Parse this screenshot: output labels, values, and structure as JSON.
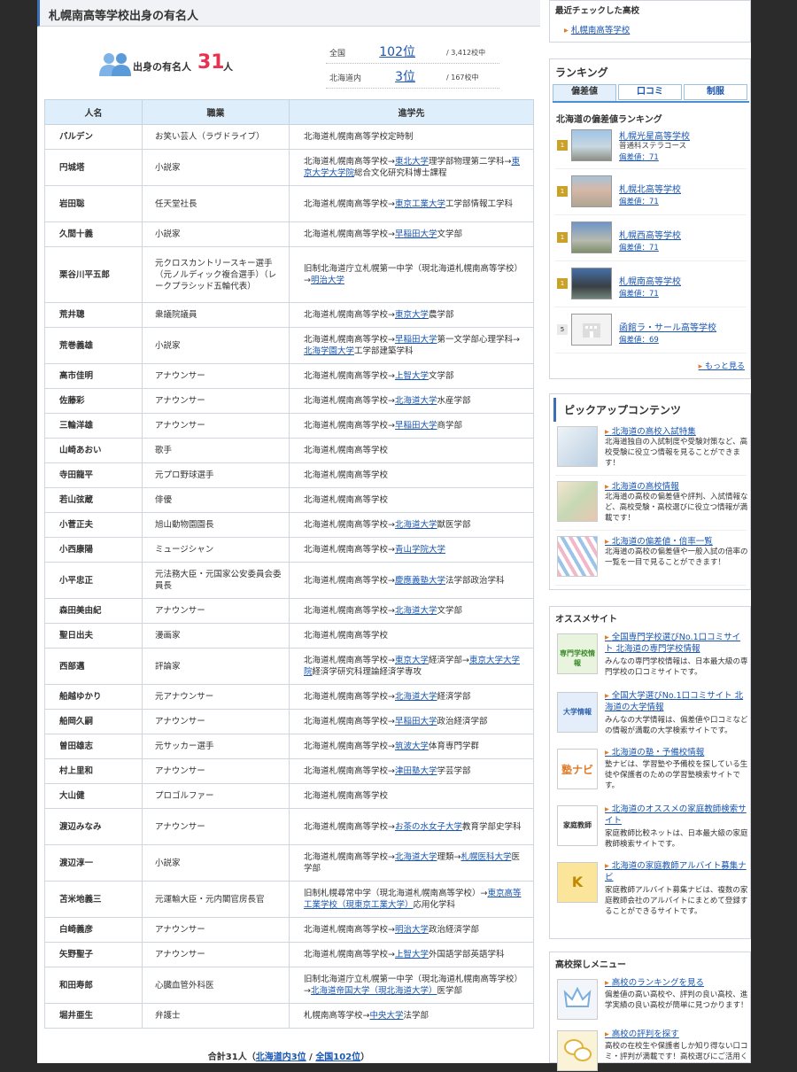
{
  "main": {
    "title": "札幌南高等学校出身の有名人",
    "count_label": "出身の有名人",
    "count": "31",
    "count_unit": "人",
    "ranks": [
      {
        "area": "全国",
        "pos": "102位",
        "total": "/ 3,412校中"
      },
      {
        "area": "北海道内",
        "pos": "3位",
        "total": "/ 167校中"
      }
    ],
    "headers": [
      "人名",
      "職業",
      "進学先"
    ],
    "rows": [
      {
        "name": "パルデン",
        "job": "お笑い芸人（ラヴドライブ）",
        "edu": [
          "北海道札幌南高等学校定時制"
        ]
      },
      {
        "name": "円城塔",
        "job": "小説家",
        "edu": [
          "北海道札幌南高等学校→",
          "@東北大学",
          "理学部物理第二学科→",
          "@東京大学大学院",
          "総合文化研究科博士課程"
        ]
      },
      {
        "name": "岩田聡",
        "job": "任天堂社長",
        "edu": [
          "北海道札幌南高等学校→",
          "@東京工業大学",
          "工学部情報工学科"
        ]
      },
      {
        "name": "久間十義",
        "job": "小説家",
        "edu": [
          "北海道札幌南高等学校→",
          "@早稲田大学",
          "文学部"
        ]
      },
      {
        "name": "栗谷川平五郎",
        "job": "元クロスカントリースキー選手（元ノルディック複合選手）（レークプラシッド五輪代表）",
        "edu": [
          "旧制北海道庁立札幌第一中学（現北海道札幌南高等学校）→",
          "@明治大学"
        ]
      },
      {
        "name": "荒井聰",
        "job": "衆議院議員",
        "edu": [
          "北海道札幌南高等学校→",
          "@東京大学",
          "農学部"
        ]
      },
      {
        "name": "荒巻義雄",
        "job": "小説家",
        "edu": [
          "北海道札幌南高等学校→",
          "@早稲田大学",
          "第一文学部心理学科→",
          "@北海学園大学",
          "工学部建築学科"
        ]
      },
      {
        "name": "高市佳明",
        "job": "アナウンサー",
        "edu": [
          "北海道札幌南高等学校→",
          "@上智大学",
          "文学部"
        ]
      },
      {
        "name": "佐藤彩",
        "job": "アナウンサー",
        "edu": [
          "北海道札幌南高等学校→",
          "@北海道大学",
          "水産学部"
        ]
      },
      {
        "name": "三輪洋雄",
        "job": "アナウンサー",
        "edu": [
          "北海道札幌南高等学校→",
          "@早稲田大学",
          "商学部"
        ]
      },
      {
        "name": "山崎あおい",
        "job": "歌手",
        "edu": [
          "北海道札幌南高等学校"
        ]
      },
      {
        "name": "寺田龍平",
        "job": "元プロ野球選手",
        "edu": [
          "北海道札幌南高等学校"
        ]
      },
      {
        "name": "若山弦蔵",
        "job": "俳優",
        "edu": [
          "北海道札幌南高等学校"
        ]
      },
      {
        "name": "小菅正夫",
        "job": "旭山動物園園長",
        "edu": [
          "北海道札幌南高等学校→",
          "@北海道大学",
          "獣医学部"
        ]
      },
      {
        "name": "小西康陽",
        "job": "ミュージシャン",
        "edu": [
          "北海道札幌南高等学校→",
          "@青山学院大学"
        ]
      },
      {
        "name": "小平忠正",
        "job": "元法務大臣・元国家公安委員会委員長",
        "edu": [
          "北海道札幌南高等学校→",
          "@慶應義塾大学",
          "法学部政治学科"
        ]
      },
      {
        "name": "森田美由紀",
        "job": "アナウンサー",
        "edu": [
          "北海道札幌南高等学校→",
          "@北海道大学",
          "文学部"
        ]
      },
      {
        "name": "聖日出夫",
        "job": "漫画家",
        "edu": [
          "北海道札幌南高等学校"
        ]
      },
      {
        "name": "西部邁",
        "job": "評論家",
        "edu": [
          "北海道札幌南高等学校→",
          "@東京大学",
          "経済学部→",
          "@東京大学大学院",
          "経済学研究科理論経済学専攻"
        ]
      },
      {
        "name": "船越ゆかり",
        "job": "元アナウンサー",
        "edu": [
          "北海道札幌南高等学校→",
          "@北海道大学",
          "経済学部"
        ]
      },
      {
        "name": "船岡久嗣",
        "job": "アナウンサー",
        "edu": [
          "北海道札幌南高等学校→",
          "@早稲田大学",
          "政治経済学部"
        ]
      },
      {
        "name": "曽田雄志",
        "job": "元サッカー選手",
        "edu": [
          "北海道札幌南高等学校→",
          "@筑波大学",
          "体育専門学群"
        ]
      },
      {
        "name": "村上里和",
        "job": "アナウンサー",
        "edu": [
          "北海道札幌南高等学校→",
          "@津田塾大学",
          "学芸学部"
        ]
      },
      {
        "name": "大山健",
        "job": "プロゴルファー",
        "edu": [
          "北海道札幌南高等学校"
        ]
      },
      {
        "name": "渡辺みなみ",
        "job": "アナウンサー",
        "edu": [
          "北海道札幌南高等学校→",
          "@お茶の水女子大学",
          "教育学部史学科"
        ]
      },
      {
        "name": "渡辺淳一",
        "job": "小説家",
        "edu": [
          "北海道札幌南高等学校→",
          "@北海道大学",
          "理類→",
          "@札幌医科大学",
          "医学部"
        ]
      },
      {
        "name": "苫米地義三",
        "job": "元運輸大臣・元内閣官房長官",
        "edu": [
          "旧制札幌尋常中学（現北海道札幌南高等学校）→",
          "@東京高等工業学校（現東京工業大学）",
          "応用化学科"
        ]
      },
      {
        "name": "白崎義彦",
        "job": "アナウンサー",
        "edu": [
          "北海道札幌南高等学校→",
          "@明治大学",
          "政治経済学部"
        ]
      },
      {
        "name": "矢野聖子",
        "job": "アナウンサー",
        "edu": [
          "北海道札幌南高等学校→",
          "@上智大学",
          "外国語学部英語学科"
        ]
      },
      {
        "name": "和田寿郎",
        "job": "心臓血管外科医",
        "edu": [
          "旧制北海道庁立札幌第一中学（現北海道札幌南高等学校）→",
          "@北海道帝国大学（現北海道大学）",
          "医学部"
        ]
      },
      {
        "name": "堀井亜生",
        "job": "弁護士",
        "edu": [
          "札幌南高等学校→",
          "@中央大学",
          "法学部"
        ]
      }
    ],
    "total_prefix": "合計31人（",
    "total_link1": "北海道内3位",
    "total_sep": " / ",
    "total_link2": "全国102位",
    "total_suffix": "）"
  },
  "sidebar": {
    "recent_title": "最近チェックした高校",
    "recent_item": "札幌南高等学校",
    "ranking_title": "ランキング",
    "tabs": [
      "偏差値",
      "口コミ",
      "制服"
    ],
    "ranking_subtitle": "北海道の偏差値ランキング",
    "ranking": [
      {
        "badge": "1",
        "name": "札幌光星高等学校",
        "sub": "普通科ステラコース",
        "dev": "偏差値：71"
      },
      {
        "badge": "1",
        "name": "札幌北高等学校",
        "sub": "",
        "dev": "偏差値：71"
      },
      {
        "badge": "1",
        "name": "札幌西高等学校",
        "sub": "",
        "dev": "偏差値：71"
      },
      {
        "badge": "1",
        "name": "札幌南高等学校",
        "sub": "",
        "dev": "偏差値：71"
      },
      {
        "badge": "5",
        "name": "函館ラ・サール高等学校",
        "sub": "",
        "dev": "偏差値：69"
      }
    ],
    "more": "もっと見る",
    "pickup_title": "ピックアップコンテンツ",
    "pickup": [
      {
        "title": "北海道の高校入試特集",
        "desc": "北海道独自の入試制度や受験対策など、高校受験に役立つ情報を見ることができます！"
      },
      {
        "title": "北海道の高校情報",
        "desc": "北海道の高校の偏差値や評判、入試情報など、高校受験・高校選びに役立つ情報が満載です！"
      },
      {
        "title": "北海道の偏差値・倍率一覧",
        "desc": "北海道の高校の偏差値や一般入試の倍率の一覧を一目で見ることができます！"
      }
    ],
    "osusume_title": "オススメサイト",
    "osusume": [
      {
        "title": "全国専門学校選びNo.1口コミサイト 北海道の専門学校情報",
        "desc": "みんなの専門学校情報は、日本最大級の専門学校の口コミサイトです。",
        "logo": "専門学校情報"
      },
      {
        "title": "全国大学選びNo.1口コミサイト 北海道の大学情報",
        "desc": "みんなの大学情報は、偏差値や口コミなどの情報が満載の大学検索サイトです。",
        "logo": "大学情報"
      },
      {
        "title": "北海道の塾・予備校情報",
        "desc": "塾ナビは、学習塾や予備校を探している生徒や保護者のための学習塾検索サイトです。",
        "logo": "塾ナビ"
      },
      {
        "title": "北海道のオススメの家庭教師検索サイト",
        "desc": "家庭教師比較ネットは、日本最大級の家庭教師検索サイトです。",
        "logo": "家庭教師"
      },
      {
        "title": "北海道の家庭教師アルバイト募集ナビ",
        "desc": "家庭教師アルバイト募集ナビは、複数の家庭教師会社のアルバイトにまとめて登録することができるサイトです。",
        "logo": "K"
      }
    ],
    "menu_title": "高校探しメニュー",
    "menu": [
      {
        "title": "高校のランキングを見る",
        "desc": "偏差値の高い高校や、評判の良い高校、進学実績の良い高校が簡単に見つかります！"
      },
      {
        "title": "高校の評判を探す",
        "desc": "高校の在校生や保護者しか知り得ない口コミ・評判が満載です！高校選びにご活用く"
      }
    ]
  }
}
